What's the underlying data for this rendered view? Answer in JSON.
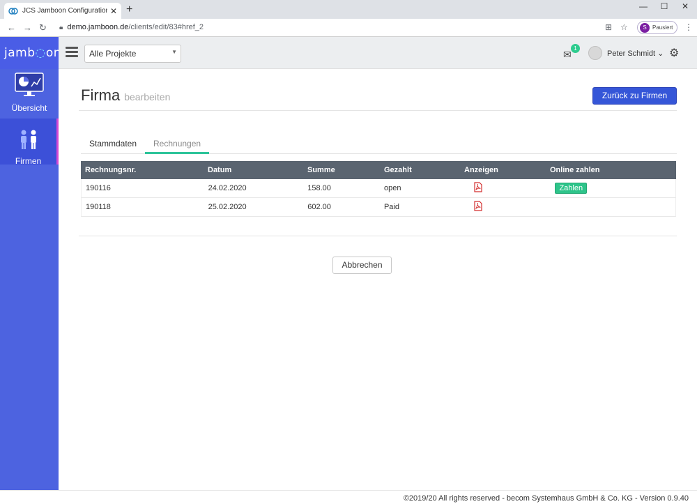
{
  "browser": {
    "tab_title": "JCS Jamboon Configuration Serv",
    "url_host": "demo.jamboon.de",
    "url_path": "/clients/edit/83#href_2",
    "profile_initial": "S",
    "profile_status": "Pausiert"
  },
  "header": {
    "logo_prefix": "jamb",
    "logo_suffix": "on",
    "project_select": "Alle Projekte",
    "mail_count": "1",
    "user_name": "Peter Schmidt"
  },
  "sidebar": {
    "items": [
      {
        "label": "Übersicht"
      },
      {
        "label": "Firmen"
      }
    ]
  },
  "page": {
    "title": "Firma",
    "subtitle": "bearbeiten",
    "back_button": "Zurück zu Firmen",
    "tabs": [
      {
        "label": "Stammdaten"
      },
      {
        "label": "Rechnungen"
      }
    ],
    "cancel_button": "Abbrechen"
  },
  "invoices": {
    "headers": [
      "Rechnungsnr.",
      "Datum",
      "Summe",
      "Gezahlt",
      "Anzeigen",
      "Online zahlen"
    ],
    "rows": [
      {
        "number": "190116",
        "date": "24.02.2020",
        "sum": "158.00",
        "paid": "open",
        "pay_label": "Zahlen"
      },
      {
        "number": "190118",
        "date": "25.02.2020",
        "sum": "602.00",
        "paid": "Paid",
        "pay_label": ""
      }
    ]
  },
  "footer": {
    "text": "©2019/20 All rights reserved - becom Systemhaus GmbH & Co. KG - Version 0.9.40"
  },
  "colors": {
    "sidebar": "#4d63e0",
    "primary_button": "#3556d8",
    "accent": "#2ec49a",
    "table_header": "#5a6470"
  }
}
